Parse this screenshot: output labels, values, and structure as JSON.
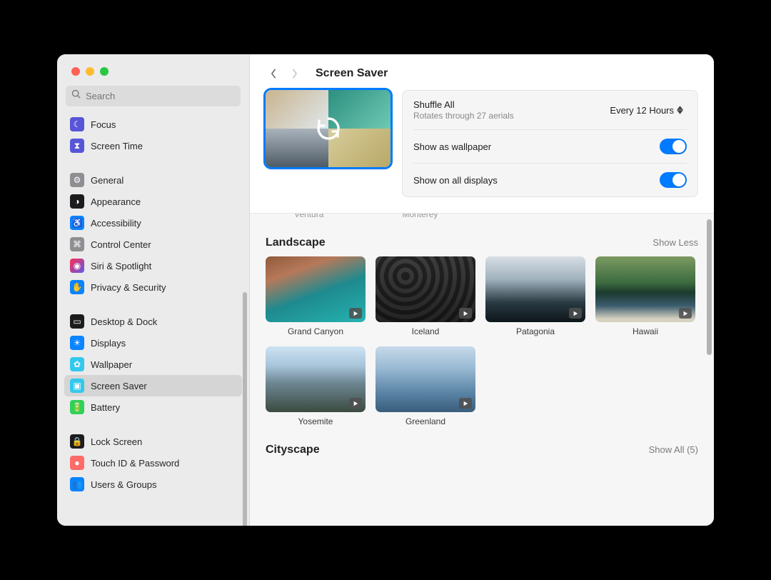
{
  "search": {
    "placeholder": "Search"
  },
  "sidebar": {
    "items": [
      {
        "label": "Focus",
        "bg": "#5856d6",
        "glyph": "☾"
      },
      {
        "label": "Screen Time",
        "bg": "#5856d6",
        "glyph": "⧗"
      },
      {
        "label": "General",
        "bg": "#8e8e93",
        "glyph": "⚙"
      },
      {
        "label": "Appearance",
        "bg": "#1c1c1e",
        "glyph": "◑"
      },
      {
        "label": "Accessibility",
        "bg": "#0a84ff",
        "glyph": "♿"
      },
      {
        "label": "Control Center",
        "bg": "#8e8e93",
        "glyph": "⌘"
      },
      {
        "label": "Siri & Spotlight",
        "bg": "linear-gradient(135deg,#ff2d55,#5e5ce6)",
        "glyph": "◉"
      },
      {
        "label": "Privacy & Security",
        "bg": "#0a84ff",
        "glyph": "✋"
      },
      {
        "label": "Desktop & Dock",
        "bg": "#1c1c1e",
        "glyph": "▭"
      },
      {
        "label": "Displays",
        "bg": "#0a84ff",
        "glyph": "☀"
      },
      {
        "label": "Wallpaper",
        "bg": "#34c8ed",
        "glyph": "✿"
      },
      {
        "label": "Screen Saver",
        "bg": "#34c8ed",
        "glyph": "▣",
        "selected": true
      },
      {
        "label": "Battery",
        "bg": "#30d158",
        "glyph": "🔋"
      },
      {
        "label": "Lock Screen",
        "bg": "#1c1c1e",
        "glyph": "🔒"
      },
      {
        "label": "Touch ID & Password",
        "bg": "#ff6b6b",
        "glyph": "●"
      },
      {
        "label": "Users & Groups",
        "bg": "#0a84ff",
        "glyph": "👥"
      }
    ]
  },
  "title": "Screen Saver",
  "hero": {
    "shuffle_title": "Shuffle All",
    "shuffle_sub": "Rotates through 27 aerials",
    "shuffle_value": "Every 12 Hours",
    "row2": "Show as wallpaper",
    "row3": "Show on all displays"
  },
  "cutoff": {
    "a": "Ventura",
    "b": "Monterey"
  },
  "sections": [
    {
      "title": "Landscape",
      "action": "Show Less",
      "items": [
        {
          "label": "Grand Canyon",
          "cls": "canyon"
        },
        {
          "label": "Iceland",
          "cls": "iceland"
        },
        {
          "label": "Patagonia",
          "cls": "patagonia"
        },
        {
          "label": "Hawaii",
          "cls": "hawaii"
        },
        {
          "label": "Yosemite",
          "cls": "yosemite"
        },
        {
          "label": "Greenland",
          "cls": "greenland"
        }
      ]
    },
    {
      "title": "Cityscape",
      "action": "Show All (5)",
      "items": []
    }
  ]
}
